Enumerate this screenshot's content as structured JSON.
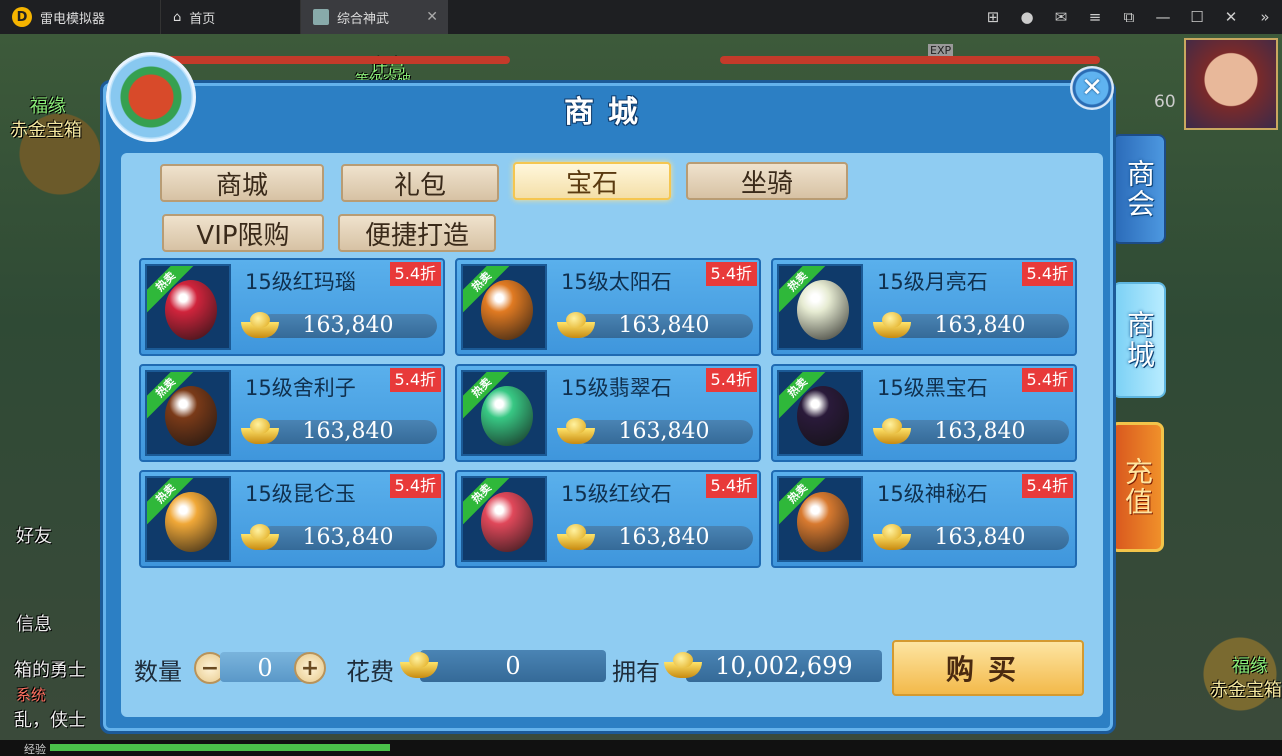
{
  "emulator": {
    "app_name": "雷电模拟器",
    "tabs": [
      {
        "label": "首页"
      },
      {
        "label": "综合神武"
      }
    ]
  },
  "background": {
    "top_left_label_1": "福缘",
    "top_left_label_2": "赤金宝箱",
    "npc_name_top": "许嵩",
    "npc_sub_top": "等级突破",
    "left_labels": [
      "好友",
      "信息"
    ],
    "left_chat_1": "箱的勇士",
    "left_chat_2": "系统",
    "left_chat_3": "乱，侠士",
    "bottom_right_label_1": "福缘",
    "bottom_right_label_2": "赤金宝箱",
    "exp_label": "经验",
    "exp_tag": "EXP",
    "level": "60"
  },
  "side_tabs": {
    "shanghui": "商会",
    "shangcheng": "商城",
    "chongzhi": "充值"
  },
  "shop": {
    "title": "商城",
    "tabs": [
      {
        "label": "商城",
        "active": false
      },
      {
        "label": "礼包",
        "active": false
      },
      {
        "label": "宝石",
        "active": true
      },
      {
        "label": "坐骑",
        "active": false
      },
      {
        "label": "VIP限购",
        "active": false
      },
      {
        "label": "便捷打造",
        "active": false
      }
    ],
    "items": [
      {
        "name": "15级红玛瑙",
        "price": "163,840",
        "discount": "5.4折",
        "tag": "热卖",
        "color": "#d0243c"
      },
      {
        "name": "15级太阳石",
        "price": "163,840",
        "discount": "5.4折",
        "tag": "热卖",
        "color": "#e07a22"
      },
      {
        "name": "15级月亮石",
        "price": "163,840",
        "discount": "5.4折",
        "tag": "热卖",
        "color": "#e6ebd2"
      },
      {
        "name": "15级舍利子",
        "price": "163,840",
        "discount": "5.4折",
        "tag": "热卖",
        "color": "#7a3a18"
      },
      {
        "name": "15级翡翠石",
        "price": "163,840",
        "discount": "5.4折",
        "tag": "热卖",
        "color": "#38c884"
      },
      {
        "name": "15级黑宝石",
        "price": "163,840",
        "discount": "5.4折",
        "tag": "热卖",
        "color": "#2a1a3a"
      },
      {
        "name": "15级昆仑玉",
        "price": "163,840",
        "discount": "5.4折",
        "tag": "热卖",
        "color": "#f0a838"
      },
      {
        "name": "15级红纹石",
        "price": "163,840",
        "discount": "5.4折",
        "tag": "热卖",
        "color": "#e0485a"
      },
      {
        "name": "15级神秘石",
        "price": "163,840",
        "discount": "5.4折",
        "tag": "热卖",
        "color": "#d87a30"
      }
    ],
    "quantity_label": "数量",
    "quantity_value": "0",
    "minus_label": "−",
    "plus_label": "+",
    "cost_label": "花费",
    "cost_value": "0",
    "own_label": "拥有",
    "own_value": "10,002,699",
    "buy_label": "购买"
  }
}
